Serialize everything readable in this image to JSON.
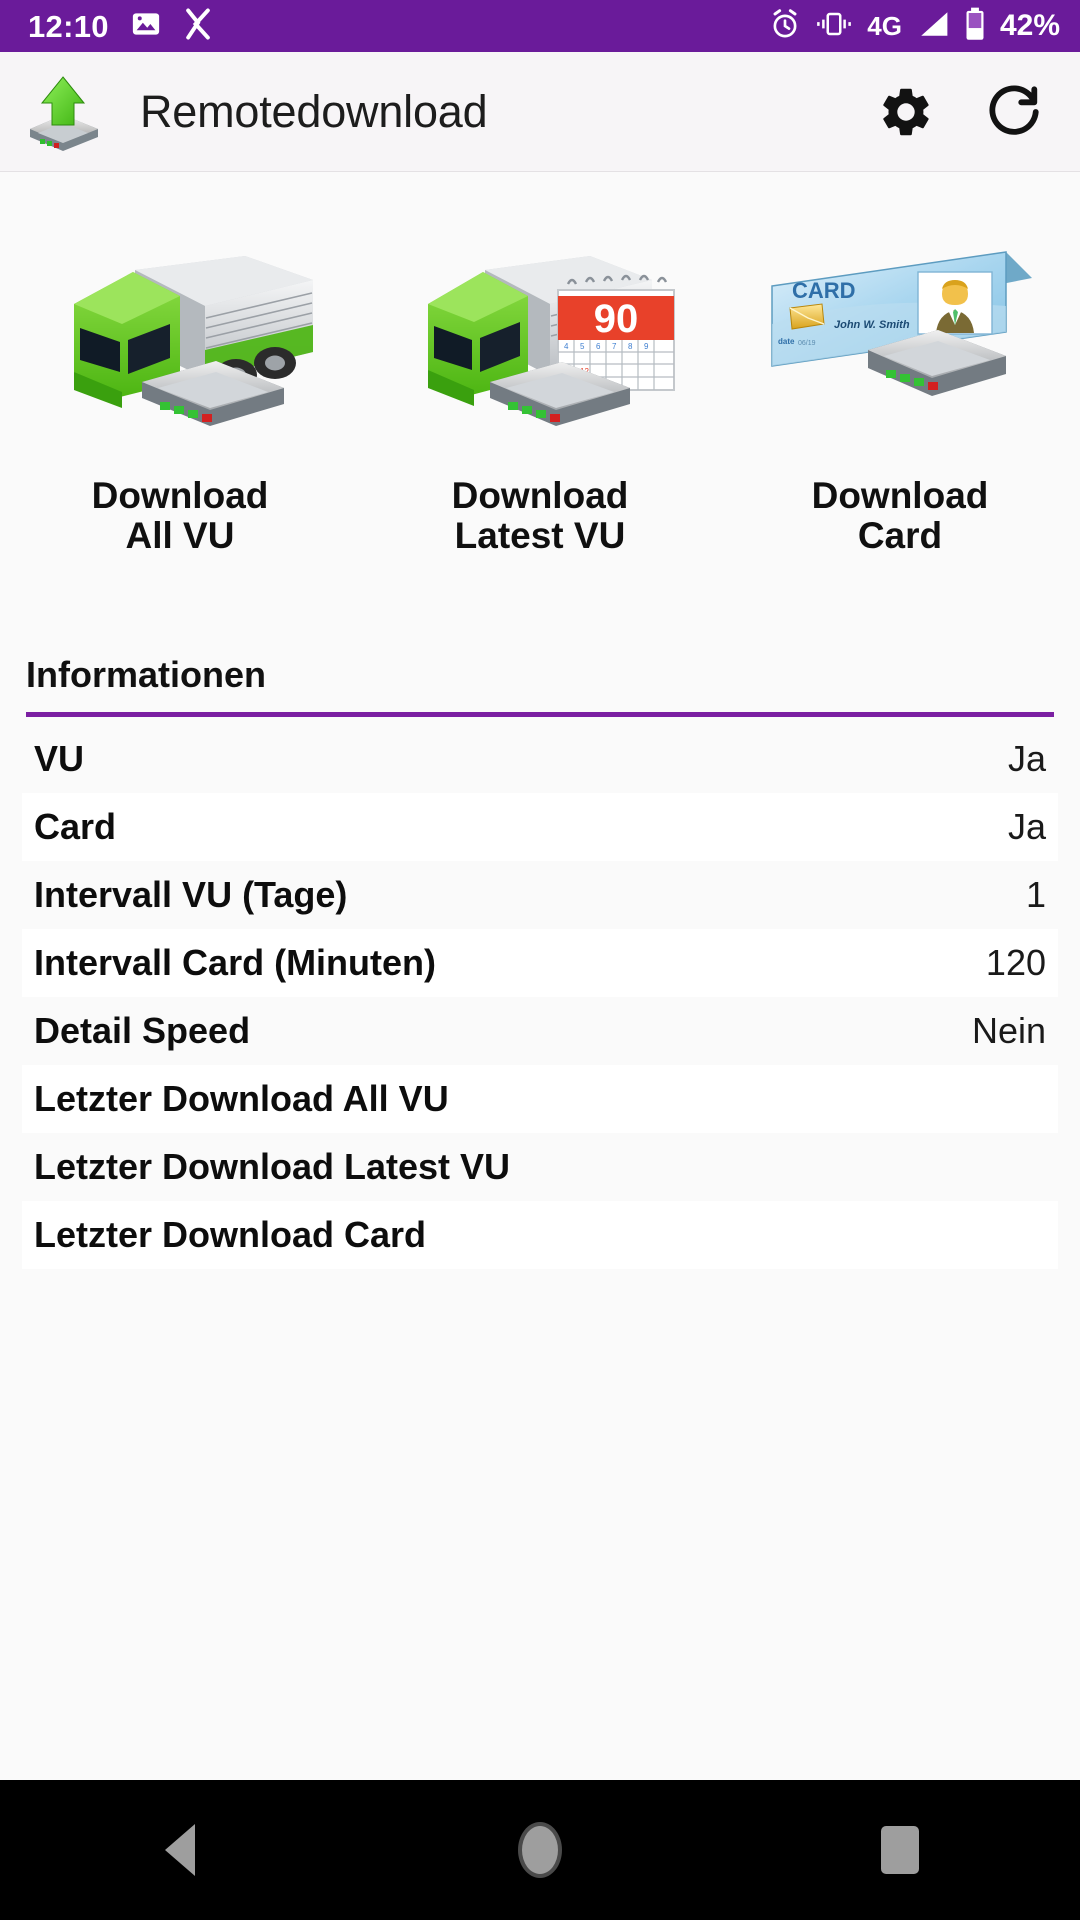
{
  "statusbar": {
    "time": "12:10",
    "battery_percent": "42%",
    "network": "4G",
    "icons": [
      "image-icon",
      "x-icon",
      "alarm-icon",
      "vibrate-icon",
      "signal-icon",
      "battery-icon"
    ],
    "background_color": "#6a1b9a"
  },
  "appbar": {
    "title": "Remotedownload",
    "app_icon": "remotedownload-app-icon",
    "settings_label": "settings-icon",
    "refresh_label": "refresh-icon",
    "background_color": "#f7f5f7"
  },
  "tiles": [
    {
      "label": "Download\nAll VU",
      "art": "truck-device-icon"
    },
    {
      "label": "Download\nLatest VU",
      "art": "truck-calendar-device-icon",
      "calendar_number": "90"
    },
    {
      "label": "Download\nCard",
      "art": "driver-card-device-icon",
      "card_title": "CARD",
      "card_name": "John W. Smith"
    }
  ],
  "section": {
    "title": "Informationen",
    "accent_color": "#7b1fa2"
  },
  "info_rows": [
    {
      "key": "VU",
      "value": "Ja"
    },
    {
      "key": "Card",
      "value": "Ja"
    },
    {
      "key": "Intervall VU (Tage)",
      "value": "1"
    },
    {
      "key": "Intervall Card (Minuten)",
      "value": "120"
    },
    {
      "key": "Detail Speed",
      "value": "Nein"
    },
    {
      "key": "Letzter Download All VU",
      "value": ""
    },
    {
      "key": "Letzter Download Latest VU",
      "value": ""
    },
    {
      "key": "Letzter Download Card",
      "value": ""
    }
  ],
  "navbar": {
    "back": "back-nav-button",
    "home": "home-nav-button",
    "recents": "recents-nav-button"
  }
}
